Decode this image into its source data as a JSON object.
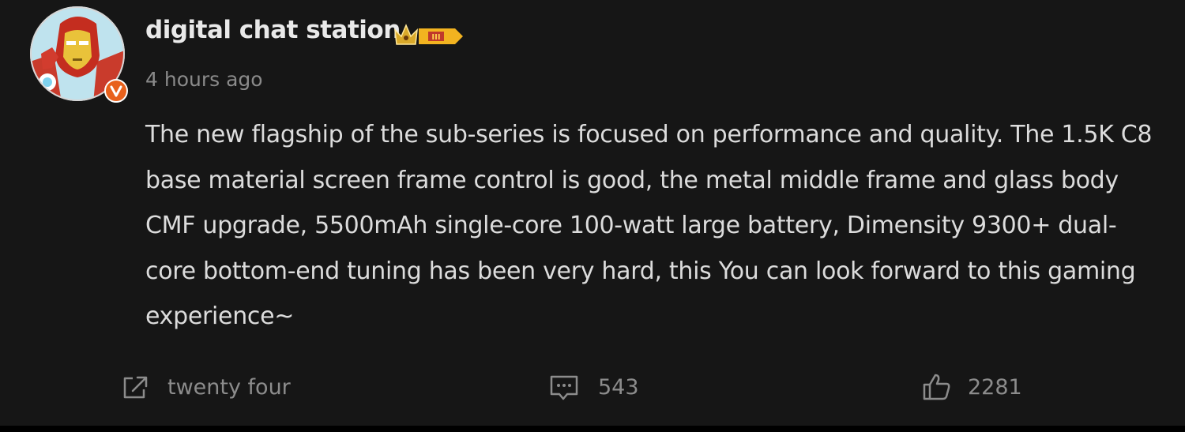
{
  "post": {
    "author": {
      "name": "digital chat station",
      "avatar_icon": "iron-man-avatar-icon",
      "verified_icon": "verified-v-icon",
      "badge_icon": "crown-level-badge-icon",
      "badge_level": "III"
    },
    "timestamp": "4 hours ago",
    "content": "The new flagship of the sub-series is focused on performance and quality. The 1.5K C8 base material screen frame control is good, the metal middle frame and glass body CMF upgrade, 5500mAh single-core 100-watt large battery, Dimensity 9300+ dual-core bottom-end tuning has been very hard, this You can look forward to this gaming experience~",
    "actions": {
      "share": {
        "icon": "share-icon",
        "count": "twenty four"
      },
      "comment": {
        "icon": "comment-icon",
        "count": "543"
      },
      "like": {
        "icon": "thumbs-up-icon",
        "count": "2281"
      }
    }
  },
  "colors": {
    "background": "#161616",
    "text": "#dcdcdc",
    "muted": "#8a8a8a",
    "verified_badge": "#e8611c",
    "level_badge": "#f2b320"
  }
}
